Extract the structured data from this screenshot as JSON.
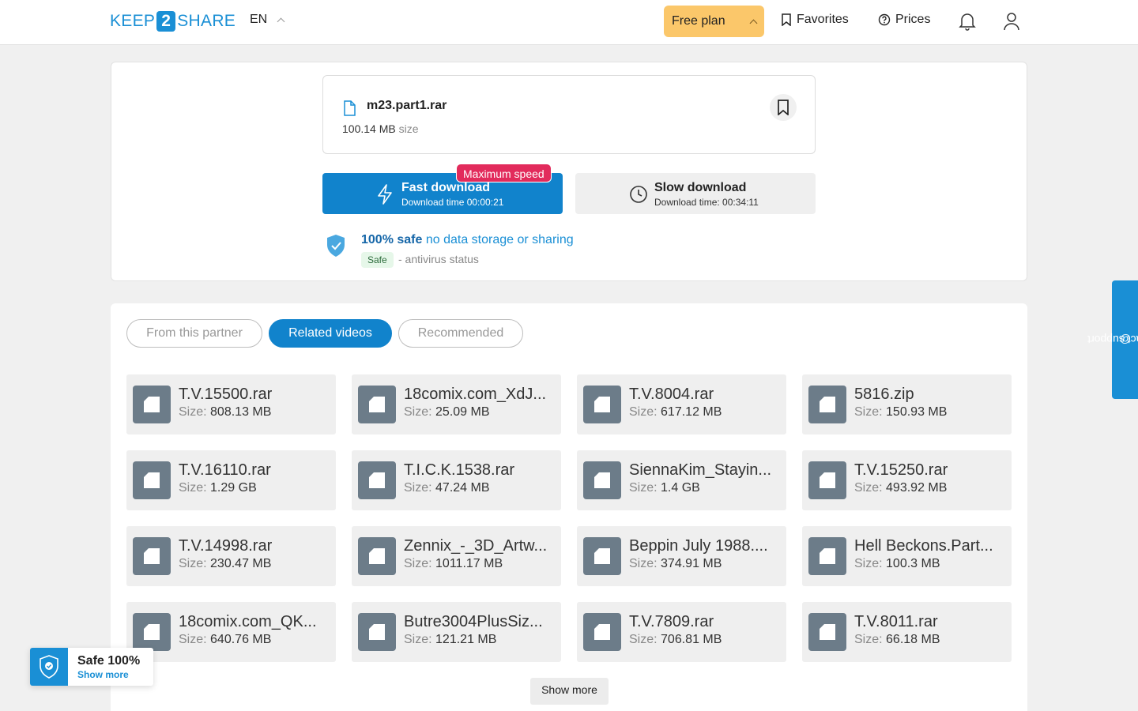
{
  "header": {
    "logo": {
      "pre": "KEEP",
      "mid": "2",
      "post": "SHARE"
    },
    "language": "EN",
    "plan_label": "Free plan",
    "favorites_label": "Favorites",
    "prices_label": "Prices"
  },
  "file": {
    "name": "m23.part1.rar",
    "size_value": "100.14 MB",
    "size_suffix": "size"
  },
  "download": {
    "fast_title": "Fast download",
    "fast_sub": "Download time 00:00:21",
    "max_badge": "Maximum speed",
    "slow_title": "Slow download",
    "slow_sub": "Download time: 00:34:11"
  },
  "safety": {
    "bold": "100% safe",
    "text": "no data storage or sharing",
    "tag": "Safe",
    "status": "- antivirus status"
  },
  "tabs": [
    "From this partner",
    "Related videos",
    "Recommended"
  ],
  "size_label": "Size:",
  "files": [
    {
      "name": "T.V.15500.rar",
      "size": "808.13 MB"
    },
    {
      "name": "18comix.com_XdJ...",
      "size": "25.09 MB"
    },
    {
      "name": "T.V.8004.rar",
      "size": "617.12 MB"
    },
    {
      "name": "5816.zip",
      "size": "150.93 MB"
    },
    {
      "name": "T.V.16110.rar",
      "size": "1.29 GB"
    },
    {
      "name": "T.I.C.K.1538.rar",
      "size": "47.24 MB"
    },
    {
      "name": "SiennaKim_Stayin...",
      "size": "1.4 GB"
    },
    {
      "name": "T.V.15250.rar",
      "size": "493.92 MB"
    },
    {
      "name": "T.V.14998.rar",
      "size": "230.47 MB"
    },
    {
      "name": "Zennix_-_3D_Artw...",
      "size": "1011.17 MB"
    },
    {
      "name": "Beppin July 1988....",
      "size": "374.91 MB"
    },
    {
      "name": "Hell Beckons.Part...",
      "size": "100.3 MB"
    },
    {
      "name": "18comix.com_QK...",
      "size": "640.76 MB"
    },
    {
      "name": "Butre3004PlusSiz...",
      "size": "121.21 MB"
    },
    {
      "name": "T.V.7809.rar",
      "size": "706.81 MB"
    },
    {
      "name": "T.V.8011.rar",
      "size": "66.18 MB"
    }
  ],
  "show_more": "Show more",
  "support": "contact support",
  "safe_widget": {
    "title": "Safe 100%",
    "link": "Show more"
  },
  "colors": {
    "accent": "#1183cc",
    "brand": "#1a8fd5",
    "plan": "#fbc76a",
    "badge": "#e22b5c"
  }
}
